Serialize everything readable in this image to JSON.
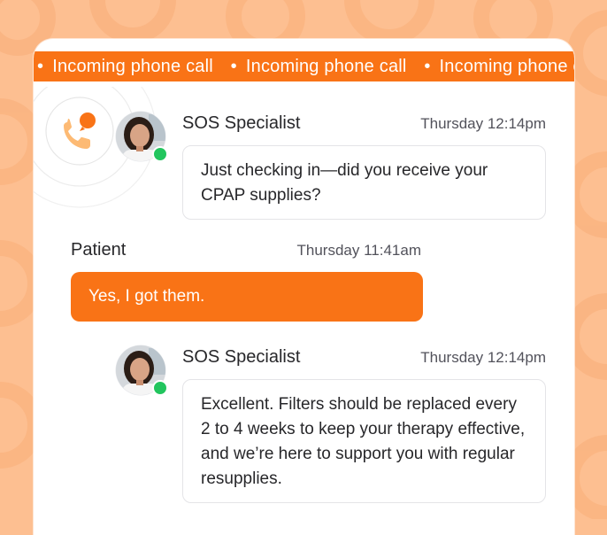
{
  "ticker": {
    "items": [
      "Incoming phone call",
      "Incoming phone call",
      "Incoming phone call"
    ]
  },
  "icons": {
    "call": "phone-incoming-icon",
    "status": "online-status-dot"
  },
  "colors": {
    "accent": "#f97316",
    "background": "#fdbf91",
    "online": "#22c55e"
  },
  "messages": [
    {
      "sender": "SOS Specialist",
      "time": "Thursday 12:14pm",
      "text": "Just checking in—did you receive your CPAP supplies?"
    },
    {
      "sender": "Patient",
      "time": "Thursday 11:41am",
      "text": "Yes, I got them."
    },
    {
      "sender": "SOS Specialist",
      "time": "Thursday 12:14pm",
      "text": "Excellent. Filters should be replaced every 2 to 4 weeks to keep your therapy effective, and we’re here to support you with regular resupplies."
    }
  ]
}
